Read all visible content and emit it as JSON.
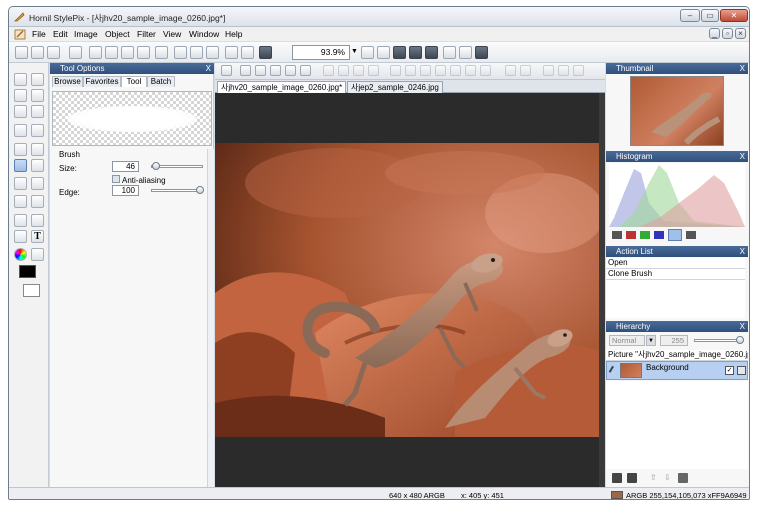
{
  "window": {
    "title": "Hornil StylePix - [사jhv20_sample_image_0260.jpg*]"
  },
  "menu": [
    "File",
    "Edit",
    "Image",
    "Object",
    "Filter",
    "View",
    "Window",
    "Help"
  ],
  "toolbar": {
    "zoom": "93.9%"
  },
  "tool_options": {
    "title": "Tool Options",
    "tabs": [
      "Browse",
      "Favorites",
      "Tool",
      "Batch"
    ],
    "active_tab": "Tool",
    "section": "Brush",
    "size_label": "Size:",
    "size_value": "46",
    "anti_aliasing_label": "Anti-aliasing",
    "edge_label": "Edge:",
    "edge_value": "100",
    "size_slider_pct": 5,
    "edge_slider_pct": 100
  },
  "documents": {
    "tabs": [
      "사jhv20_sample_image_0260.jpg*",
      "사jep2_sample_0246.jpg"
    ],
    "active": 0
  },
  "panels": {
    "thumbnail": "Thumbnail",
    "histogram": "Histogram",
    "action_list": "Action List",
    "actions": [
      "Open",
      "Clone Brush"
    ],
    "hierarchy": "Hierarchy",
    "blend_mode": "Normal",
    "opacity": "255",
    "picture_label": "Picture \"사jhv20_sample_image_0260.jpg",
    "layer_name": "Background"
  },
  "status": {
    "size": "640 x 480 ARGB",
    "coords": "x: 405 y: 451",
    "color": "ARGB 255,154,105,073 xFF9A6949",
    "swatch": "#9a6949"
  },
  "colors": {
    "foreground": "#000000",
    "background": "#ffffff",
    "accent": "#2f4f7c"
  }
}
